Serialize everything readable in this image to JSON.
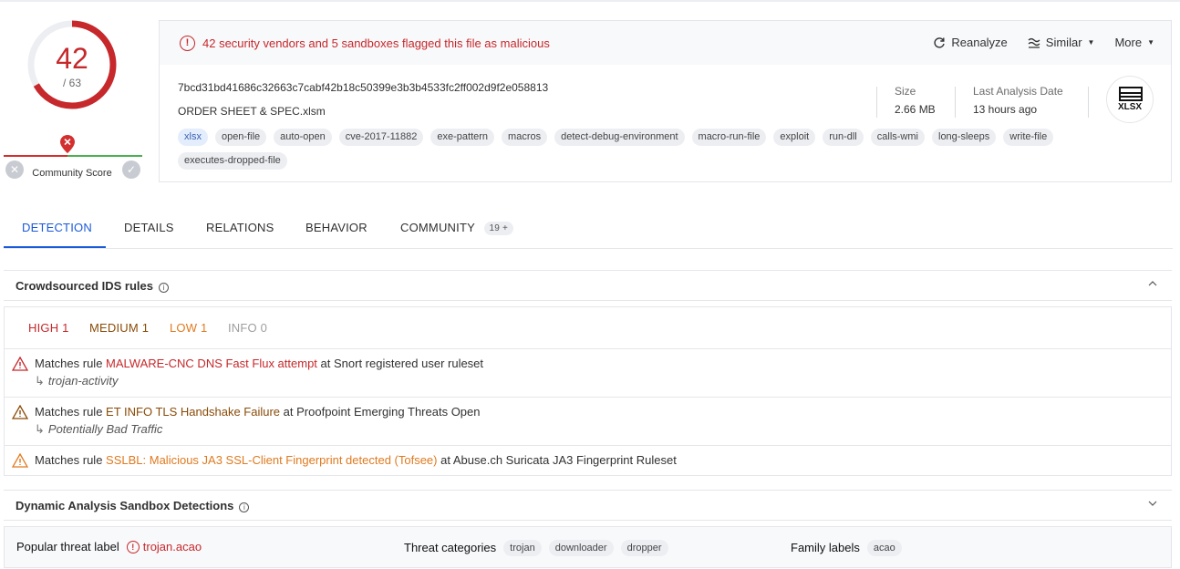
{
  "score": {
    "detections": "42",
    "total": "/ 63",
    "fraction": 0.667,
    "color": "#c6282b"
  },
  "community": {
    "label": "Community Score",
    "down_icon": "x-icon",
    "up_icon": "check-icon"
  },
  "summary": {
    "alert": "42 security vendors and 5 sandboxes flagged this file as malicious",
    "actions": {
      "reanalyze": "Reanalyze",
      "similar": "Similar",
      "more": "More"
    },
    "hash": "7bcd31bd41686c32663c7cabf42b18c50399e3b3b4533fc2ff002d9f2e058813",
    "filename": "ORDER SHEET & SPEC.xlsm",
    "tags": [
      "xlsx",
      "open-file",
      "auto-open",
      "cve-2017-11882",
      "exe-pattern",
      "macros",
      "detect-debug-environment",
      "macro-run-file",
      "exploit",
      "run-dll",
      "calls-wmi",
      "long-sleeps",
      "write-file",
      "executes-dropped-file"
    ],
    "size_label": "Size",
    "size_value": "2.66 MB",
    "date_label": "Last Analysis Date",
    "date_value": "13 hours ago",
    "filetype": "XLSX"
  },
  "tabs": {
    "detection": "DETECTION",
    "details": "DETAILS",
    "relations": "RELATIONS",
    "behavior": "BEHAVIOR",
    "community": "COMMUNITY",
    "community_badge": "19 +"
  },
  "ids": {
    "title": "Crowdsourced IDS rules",
    "high": "HIGH 1",
    "medium": "MEDIUM 1",
    "low": "LOW 1",
    "info": "INFO 0",
    "colors": {
      "high": "#c6282b",
      "medium": "#8a4b08",
      "low": "#e07a1f",
      "info": "#9e9e9e"
    },
    "rules": [
      {
        "prefix": "Matches rule",
        "rule": "MALWARE-CNC DNS Fast Flux attempt",
        "suffix": "at Snort registered user ruleset",
        "category": "trojan-activity"
      },
      {
        "prefix": "Matches rule",
        "rule": "ET INFO TLS Handshake Failure",
        "suffix": "at Proofpoint Emerging Threats Open",
        "category": "Potentially Bad Traffic"
      },
      {
        "prefix": "Matches rule",
        "rule": "SSLBL: Malicious JA3 SSL-Client Fingerprint detected (Tofsee)",
        "suffix": "at Abuse.ch Suricata JA3 Fingerprint Ruleset"
      }
    ]
  },
  "sandbox": {
    "title": "Dynamic Analysis Sandbox Detections"
  },
  "threat": {
    "popular_label": "Popular threat label",
    "popular_value": "trojan.acao",
    "categories_label": "Threat categories",
    "categories": [
      "trojan",
      "downloader",
      "dropper"
    ],
    "family_label": "Family labels",
    "families": [
      "acao"
    ]
  }
}
